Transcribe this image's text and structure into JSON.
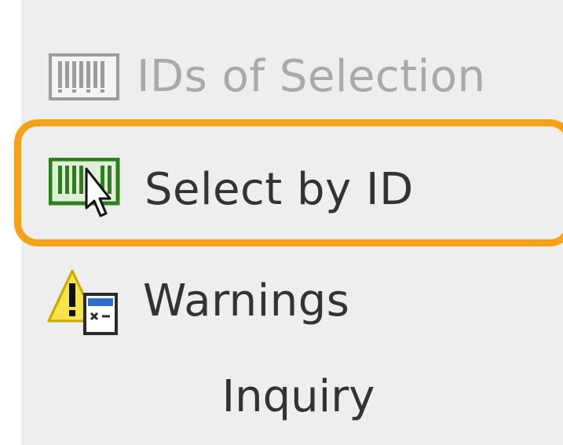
{
  "ribbon": {
    "items": [
      {
        "label": "IDs of  Selection",
        "icon": "barcode-icon",
        "enabled": false
      },
      {
        "label": "Select  by ID",
        "icon": "barcode-select-icon",
        "enabled": true,
        "highlighted": true
      },
      {
        "label": "Warnings",
        "icon": "warning-icon",
        "enabled": true
      }
    ],
    "group_label": "Inquiry"
  },
  "colors": {
    "highlight": "#f5a21b",
    "panel_bg": "#eeeeee",
    "disabled_text": "#a9a9a9",
    "text": "#333333",
    "barcode_green": "#2e7d1e"
  }
}
